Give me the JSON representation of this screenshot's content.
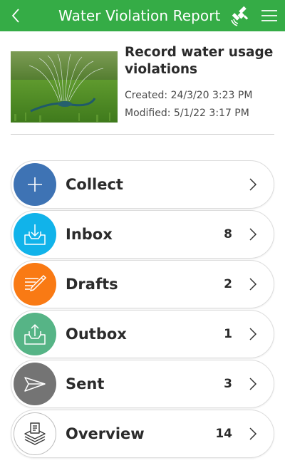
{
  "header": {
    "title": "Water Violation Report",
    "back_icon": "chevron-left-icon",
    "gps_icon": "satellite-icon",
    "menu_icon": "hamburger-menu-icon",
    "color": "#35ac46"
  },
  "survey": {
    "name": "Record water usage violations",
    "created": "Created: 24/3/20 3:23 PM",
    "modified": "Modified: 5/1/22 3:17 PM"
  },
  "folders": [
    {
      "label": "Collect",
      "count": "",
      "icon": "plus-icon",
      "color": "#3e73b4"
    },
    {
      "label": "Inbox",
      "count": "8",
      "icon": "inbox-tray-icon",
      "color": "#11b3ea"
    },
    {
      "label": "Drafts",
      "count": "2",
      "icon": "edit-pencil-icon",
      "color": "#f97a14"
    },
    {
      "label": "Outbox",
      "count": "1",
      "icon": "outbox-upload-icon",
      "color": "#56b486"
    },
    {
      "label": "Sent",
      "count": "3",
      "icon": "paper-plane-icon",
      "color": "#747474"
    },
    {
      "label": "Overview",
      "count": "14",
      "icon": "layers-stack-icon",
      "color": "#ffffff"
    }
  ]
}
